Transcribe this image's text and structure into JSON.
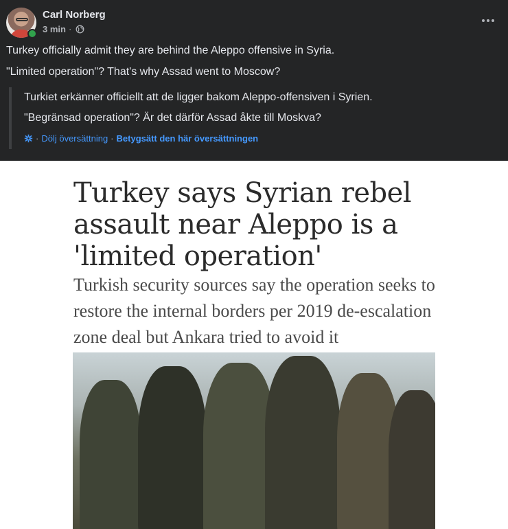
{
  "post": {
    "author": "Carl Norberg",
    "time": "3 min",
    "separator": "·",
    "visibility_icon": "globe-icon",
    "more_icon": "more-dots-icon",
    "text_lines": [
      "Turkey officially admit they are behind the Aleppo offensive in Syria.",
      "\"Limited operation\"? That's why Assad went to Moscow?"
    ]
  },
  "translation": {
    "lines": [
      "Turkiet erkänner officiellt att de ligger bakom Aleppo-offensiven i Syrien.",
      "\"Begränsad operation\"? Är det därför Assad åkte till Moskva?"
    ],
    "settings_icon": "gear-icon",
    "sep": "·",
    "hide_label": "Dölj översättning",
    "rate_label": "Betygsätt den här översättningen"
  },
  "article_image": {
    "headline": "Turkey says Syrian rebel assault near Aleppo is a 'limited operation'",
    "subheadline": "Turkish security sources say the operation seeks to restore the internal borders per 2019 de-escalation zone deal but Ankara tried to avoid it"
  },
  "colors": {
    "background": "#242526",
    "text": "#e4e6eb",
    "secondary": "#b0b3b8",
    "link": "#4599ff",
    "online": "#31a24c"
  }
}
